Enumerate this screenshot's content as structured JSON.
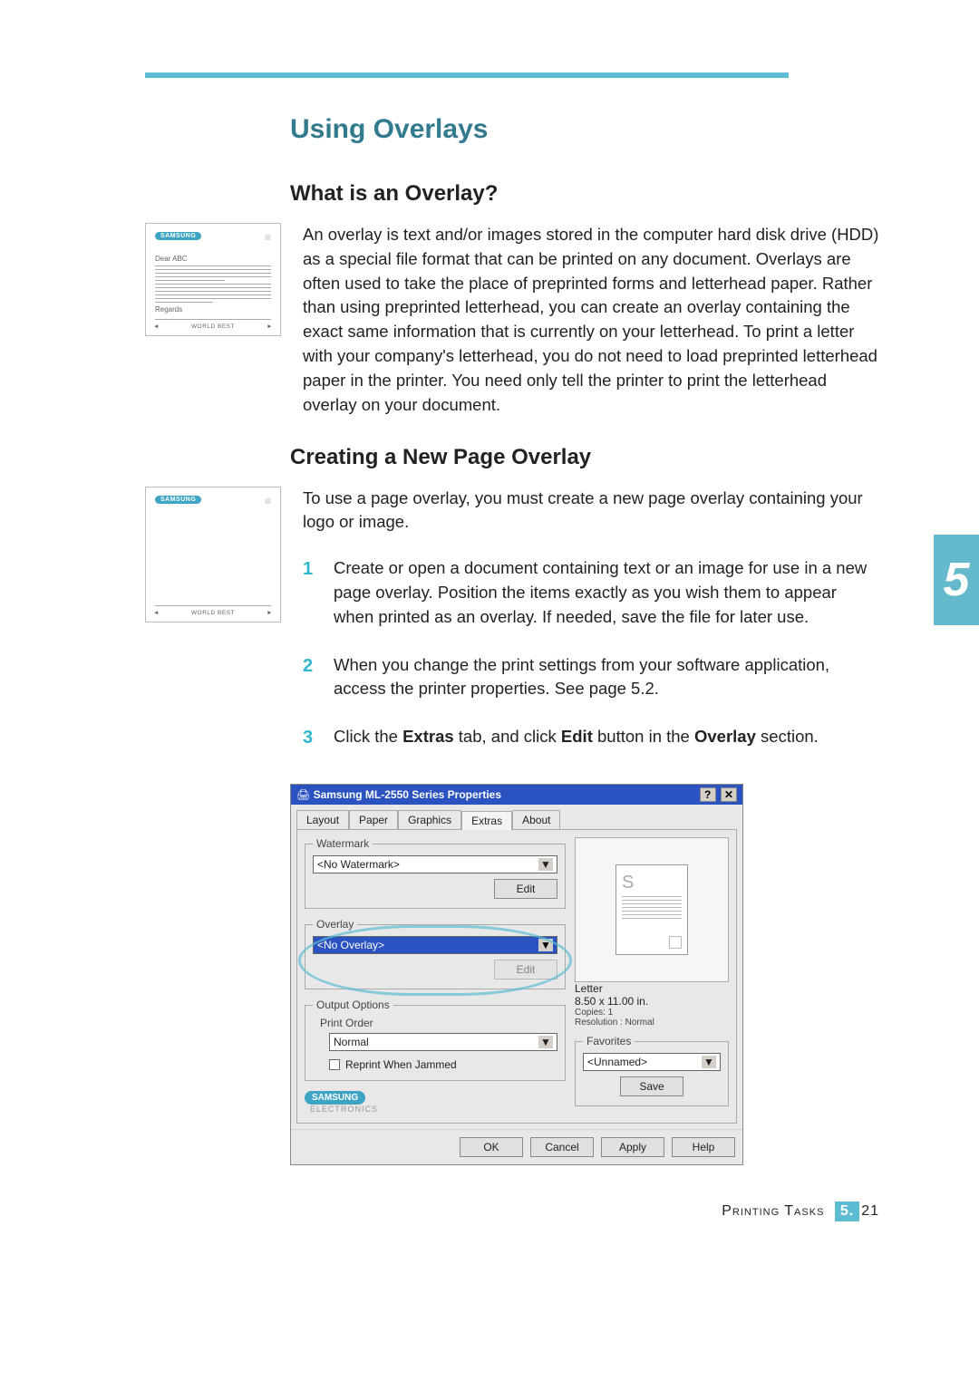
{
  "header": {
    "title": "Using Overlays"
  },
  "section1": {
    "heading": "What is an Overlay?",
    "body": "An overlay is text and/or images stored in the computer hard disk drive (HDD) as a special file format that can be printed on any document. Overlays are often used to take the place of preprinted forms and letterhead paper. Rather than using preprinted letterhead, you can create an overlay containing the exact same information that is currently on your letterhead. To print a letter with your company's letterhead, you do not need to load preprinted letterhead paper in the printer. You need only tell the printer to print the letterhead overlay on your document.",
    "thumb": {
      "logo": "SAMSUNG",
      "greeting": "Dear ABC",
      "signoff": "Regards",
      "footer": "WORLD BEST"
    }
  },
  "section2": {
    "heading": "Creating a New Page Overlay",
    "intro": "To use a page overlay, you must create a new page overlay containing your logo or image.",
    "thumb": {
      "logo": "SAMSUNG",
      "footer": "WORLD BEST"
    },
    "steps": [
      "Create or open a document containing text or an image for use in a new page overlay. Position the items exactly as you wish them to appear when printed as an overlay. If needed, save the file for later use.",
      "When you change the print settings from your software application, access the printer properties. See page 5.2.",
      "Click the Extras tab, and click Edit button in the Overlay section."
    ],
    "step3_parts": {
      "pre": "Click the ",
      "b1": "Extras",
      "mid": " tab, and click ",
      "b2": "Edit",
      "mid2": " button in the ",
      "b3": "Overlay",
      "post": " section."
    }
  },
  "dialog": {
    "title": "Samsung ML-2550 Series Properties",
    "tabs": [
      "Layout",
      "Paper",
      "Graphics",
      "Extras",
      "About"
    ],
    "active_tab": "Extras",
    "watermark": {
      "legend": "Watermark",
      "value": "<No Watermark>",
      "edit": "Edit"
    },
    "overlay": {
      "legend": "Overlay",
      "value": "<No Overlay>",
      "edit": "Edit"
    },
    "output": {
      "legend": "Output Options",
      "sub": "Print Order",
      "value": "Normal",
      "reprint": "Reprint When Jammed"
    },
    "preview": {
      "paper": "Letter",
      "size": "8.50 x 11.00 in.",
      "copies": "Copies: 1",
      "res": "Resolution : Normal"
    },
    "favorites": {
      "legend": "Favorites",
      "value": "<Unnamed>",
      "save": "Save"
    },
    "brand": {
      "name": "SAMSUNG",
      "sub": "ELECTRONICS"
    },
    "buttons": {
      "ok": "OK",
      "cancel": "Cancel",
      "apply": "Apply",
      "help": "Help"
    }
  },
  "chapter_badge": "5",
  "footer": {
    "section": "Printing Tasks",
    "chapter": "5.",
    "page": "21"
  }
}
